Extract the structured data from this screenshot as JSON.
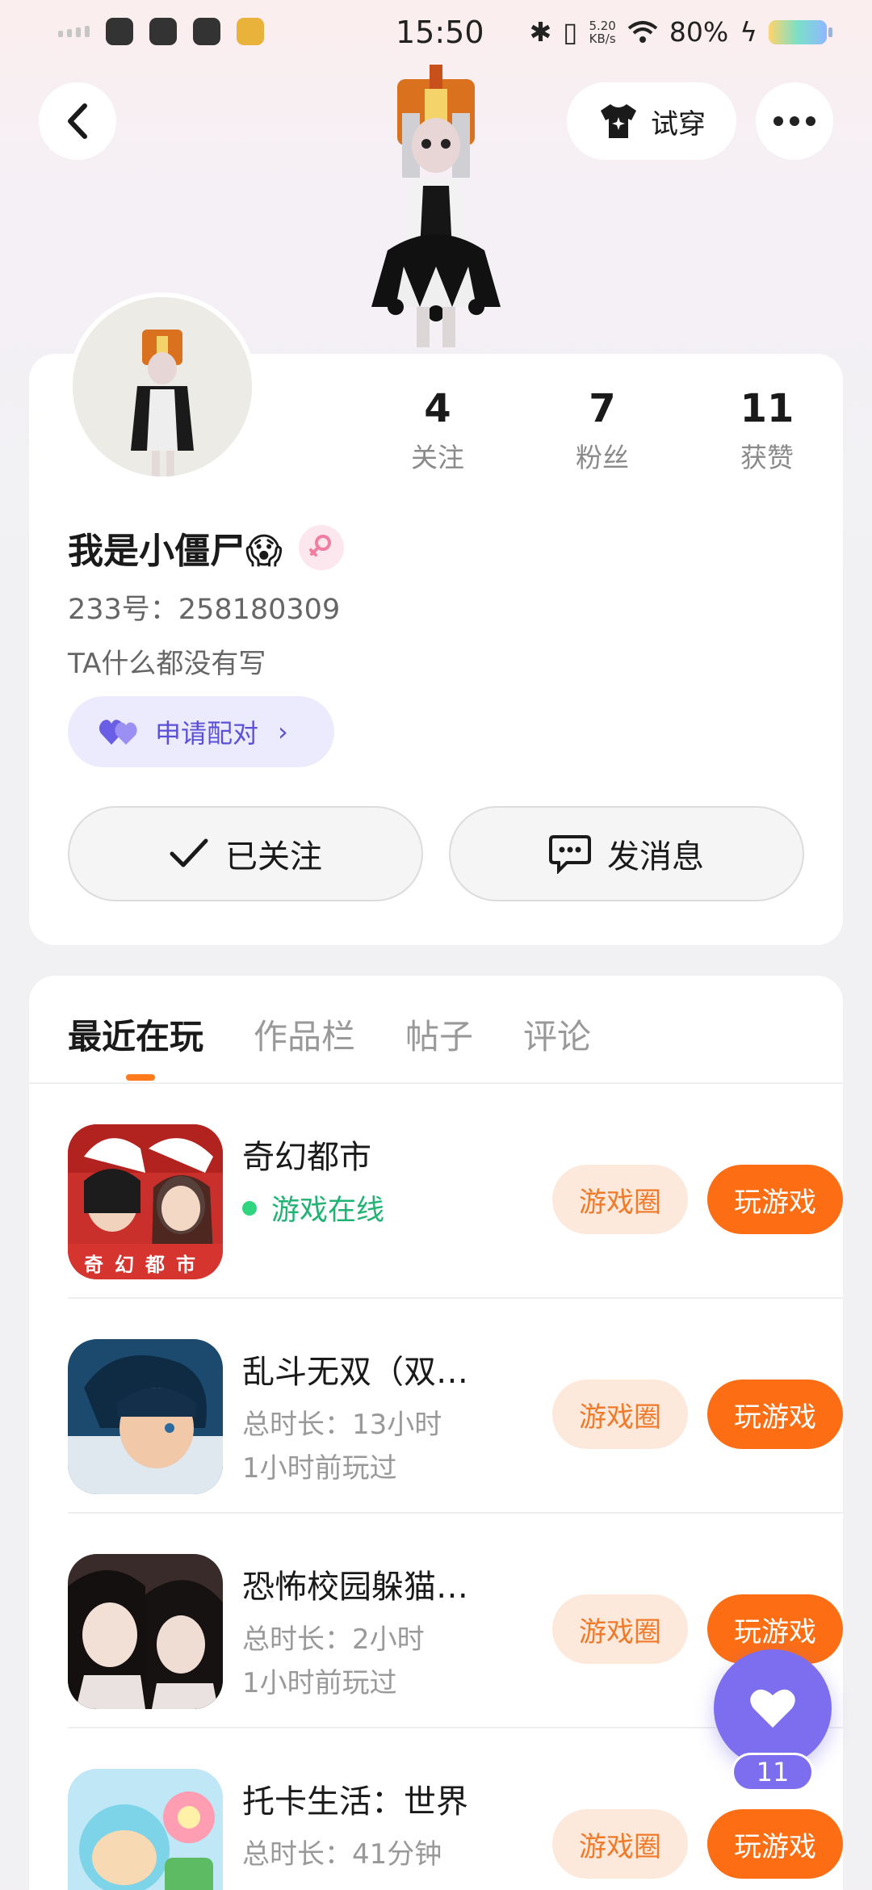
{
  "status_bar": {
    "time": "15:50",
    "net_speed_value": "5.20",
    "net_speed_unit": "KB/s",
    "battery": "80%"
  },
  "header": {
    "try_on_label": "试穿"
  },
  "profile": {
    "nickname": "我是小僵尸😱",
    "uid": "233号：258180309",
    "bio": "TA什么都没有写",
    "pair_label": "申请配对",
    "stats": [
      {
        "value": "4",
        "label": "关注"
      },
      {
        "value": "7",
        "label": "粉丝"
      },
      {
        "value": "11",
        "label": "获赞"
      }
    ],
    "follow_label": "已关注",
    "message_label": "发消息"
  },
  "tabs": [
    "最近在玩",
    "作品栏",
    "帖子",
    "评论"
  ],
  "games": [
    {
      "name": "奇幻都市",
      "status": "游戏在线",
      "icon_caption": "奇幻都市",
      "circle_label": "游戏圈",
      "play_label": "玩游戏"
    },
    {
      "name": "乱斗无双（双…",
      "duration": "总时长：13小时",
      "last_played": "1小时前玩过",
      "circle_label": "游戏圈",
      "play_label": "玩游戏"
    },
    {
      "name": "恐怖校园躲猫…",
      "duration": "总时长：2小时",
      "last_played": "1小时前玩过",
      "circle_label": "游戏圈",
      "play_label": "玩游戏"
    },
    {
      "name": "托卡生活：世界",
      "duration": "总时长：41分钟",
      "circle_label": "游戏圈",
      "play_label": "玩游戏"
    }
  ],
  "like_fab": {
    "count": "11"
  },
  "colors": {
    "accent_orange": "#fd6e14",
    "accent_purple": "#7d6ef0",
    "online_green": "#21b373"
  }
}
